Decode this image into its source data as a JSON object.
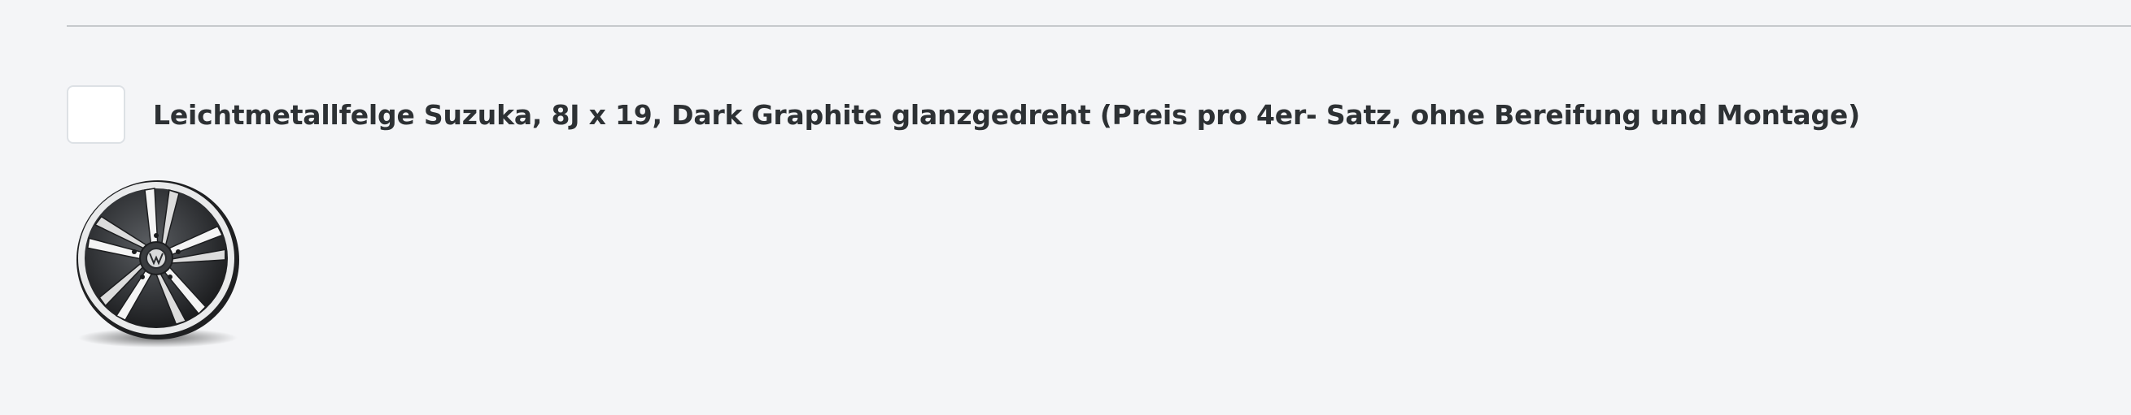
{
  "option": {
    "label": "Leichtmetallfelge Suzuka, 8J x 19, Dark Graphite glanzgedreht (Preis pro 4er- Satz, ohne Bereifung und Montage)",
    "checked": false
  },
  "image": {
    "icon": "alloy-wheel-image"
  },
  "colors": {
    "background": "#f4f5f7",
    "text": "#2d3134",
    "divider": "#c6c9cc",
    "wheel_dark": "#2a2c2f",
    "wheel_face": "#f2f2f2"
  }
}
